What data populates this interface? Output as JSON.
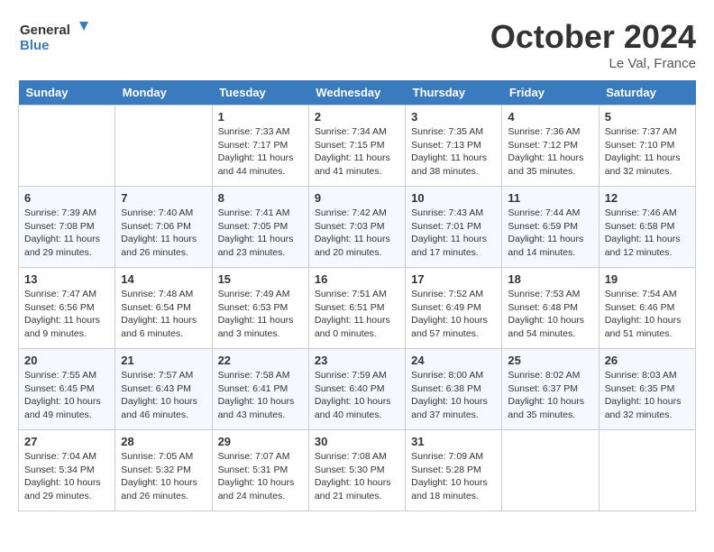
{
  "header": {
    "logo_line1": "General",
    "logo_line2": "Blue",
    "month": "October 2024",
    "location": "Le Val, France"
  },
  "days_of_week": [
    "Sunday",
    "Monday",
    "Tuesday",
    "Wednesday",
    "Thursday",
    "Friday",
    "Saturday"
  ],
  "weeks": [
    [
      {
        "day": "",
        "sunrise": "",
        "sunset": "",
        "daylight": ""
      },
      {
        "day": "",
        "sunrise": "",
        "sunset": "",
        "daylight": ""
      },
      {
        "day": "1",
        "sunrise": "Sunrise: 7:33 AM",
        "sunset": "Sunset: 7:17 PM",
        "daylight": "Daylight: 11 hours and 44 minutes."
      },
      {
        "day": "2",
        "sunrise": "Sunrise: 7:34 AM",
        "sunset": "Sunset: 7:15 PM",
        "daylight": "Daylight: 11 hours and 41 minutes."
      },
      {
        "day": "3",
        "sunrise": "Sunrise: 7:35 AM",
        "sunset": "Sunset: 7:13 PM",
        "daylight": "Daylight: 11 hours and 38 minutes."
      },
      {
        "day": "4",
        "sunrise": "Sunrise: 7:36 AM",
        "sunset": "Sunset: 7:12 PM",
        "daylight": "Daylight: 11 hours and 35 minutes."
      },
      {
        "day": "5",
        "sunrise": "Sunrise: 7:37 AM",
        "sunset": "Sunset: 7:10 PM",
        "daylight": "Daylight: 11 hours and 32 minutes."
      }
    ],
    [
      {
        "day": "6",
        "sunrise": "Sunrise: 7:39 AM",
        "sunset": "Sunset: 7:08 PM",
        "daylight": "Daylight: 11 hours and 29 minutes."
      },
      {
        "day": "7",
        "sunrise": "Sunrise: 7:40 AM",
        "sunset": "Sunset: 7:06 PM",
        "daylight": "Daylight: 11 hours and 26 minutes."
      },
      {
        "day": "8",
        "sunrise": "Sunrise: 7:41 AM",
        "sunset": "Sunset: 7:05 PM",
        "daylight": "Daylight: 11 hours and 23 minutes."
      },
      {
        "day": "9",
        "sunrise": "Sunrise: 7:42 AM",
        "sunset": "Sunset: 7:03 PM",
        "daylight": "Daylight: 11 hours and 20 minutes."
      },
      {
        "day": "10",
        "sunrise": "Sunrise: 7:43 AM",
        "sunset": "Sunset: 7:01 PM",
        "daylight": "Daylight: 11 hours and 17 minutes."
      },
      {
        "day": "11",
        "sunrise": "Sunrise: 7:44 AM",
        "sunset": "Sunset: 6:59 PM",
        "daylight": "Daylight: 11 hours and 14 minutes."
      },
      {
        "day": "12",
        "sunrise": "Sunrise: 7:46 AM",
        "sunset": "Sunset: 6:58 PM",
        "daylight": "Daylight: 11 hours and 12 minutes."
      }
    ],
    [
      {
        "day": "13",
        "sunrise": "Sunrise: 7:47 AM",
        "sunset": "Sunset: 6:56 PM",
        "daylight": "Daylight: 11 hours and 9 minutes."
      },
      {
        "day": "14",
        "sunrise": "Sunrise: 7:48 AM",
        "sunset": "Sunset: 6:54 PM",
        "daylight": "Daylight: 11 hours and 6 minutes."
      },
      {
        "day": "15",
        "sunrise": "Sunrise: 7:49 AM",
        "sunset": "Sunset: 6:53 PM",
        "daylight": "Daylight: 11 hours and 3 minutes."
      },
      {
        "day": "16",
        "sunrise": "Sunrise: 7:51 AM",
        "sunset": "Sunset: 6:51 PM",
        "daylight": "Daylight: 11 hours and 0 minutes."
      },
      {
        "day": "17",
        "sunrise": "Sunrise: 7:52 AM",
        "sunset": "Sunset: 6:49 PM",
        "daylight": "Daylight: 10 hours and 57 minutes."
      },
      {
        "day": "18",
        "sunrise": "Sunrise: 7:53 AM",
        "sunset": "Sunset: 6:48 PM",
        "daylight": "Daylight: 10 hours and 54 minutes."
      },
      {
        "day": "19",
        "sunrise": "Sunrise: 7:54 AM",
        "sunset": "Sunset: 6:46 PM",
        "daylight": "Daylight: 10 hours and 51 minutes."
      }
    ],
    [
      {
        "day": "20",
        "sunrise": "Sunrise: 7:55 AM",
        "sunset": "Sunset: 6:45 PM",
        "daylight": "Daylight: 10 hours and 49 minutes."
      },
      {
        "day": "21",
        "sunrise": "Sunrise: 7:57 AM",
        "sunset": "Sunset: 6:43 PM",
        "daylight": "Daylight: 10 hours and 46 minutes."
      },
      {
        "day": "22",
        "sunrise": "Sunrise: 7:58 AM",
        "sunset": "Sunset: 6:41 PM",
        "daylight": "Daylight: 10 hours and 43 minutes."
      },
      {
        "day": "23",
        "sunrise": "Sunrise: 7:59 AM",
        "sunset": "Sunset: 6:40 PM",
        "daylight": "Daylight: 10 hours and 40 minutes."
      },
      {
        "day": "24",
        "sunrise": "Sunrise: 8:00 AM",
        "sunset": "Sunset: 6:38 PM",
        "daylight": "Daylight: 10 hours and 37 minutes."
      },
      {
        "day": "25",
        "sunrise": "Sunrise: 8:02 AM",
        "sunset": "Sunset: 6:37 PM",
        "daylight": "Daylight: 10 hours and 35 minutes."
      },
      {
        "day": "26",
        "sunrise": "Sunrise: 8:03 AM",
        "sunset": "Sunset: 6:35 PM",
        "daylight": "Daylight: 10 hours and 32 minutes."
      }
    ],
    [
      {
        "day": "27",
        "sunrise": "Sunrise: 7:04 AM",
        "sunset": "Sunset: 5:34 PM",
        "daylight": "Daylight: 10 hours and 29 minutes."
      },
      {
        "day": "28",
        "sunrise": "Sunrise: 7:05 AM",
        "sunset": "Sunset: 5:32 PM",
        "daylight": "Daylight: 10 hours and 26 minutes."
      },
      {
        "day": "29",
        "sunrise": "Sunrise: 7:07 AM",
        "sunset": "Sunset: 5:31 PM",
        "daylight": "Daylight: 10 hours and 24 minutes."
      },
      {
        "day": "30",
        "sunrise": "Sunrise: 7:08 AM",
        "sunset": "Sunset: 5:30 PM",
        "daylight": "Daylight: 10 hours and 21 minutes."
      },
      {
        "day": "31",
        "sunrise": "Sunrise: 7:09 AM",
        "sunset": "Sunset: 5:28 PM",
        "daylight": "Daylight: 10 hours and 18 minutes."
      },
      {
        "day": "",
        "sunrise": "",
        "sunset": "",
        "daylight": ""
      },
      {
        "day": "",
        "sunrise": "",
        "sunset": "",
        "daylight": ""
      }
    ]
  ]
}
